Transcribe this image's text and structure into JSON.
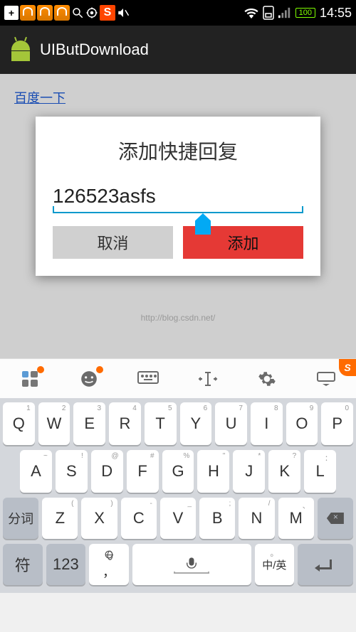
{
  "status": {
    "battery": "100",
    "time": "14:55",
    "sogou": "S"
  },
  "actionbar": {
    "title": "UIButDownload"
  },
  "page": {
    "link": "百度一下",
    "watermark": "http://blog.csdn.net/"
  },
  "dialog": {
    "title": "添加快捷回复",
    "input_value": "126523asfs",
    "cancel": "取消",
    "add": "添加"
  },
  "ime_corner": "S",
  "keys": {
    "r1": [
      {
        "main": "Q",
        "sup": "1"
      },
      {
        "main": "W",
        "sup": "2"
      },
      {
        "main": "E",
        "sup": "3"
      },
      {
        "main": "R",
        "sup": "4"
      },
      {
        "main": "T",
        "sup": "5"
      },
      {
        "main": "Y",
        "sup": "6"
      },
      {
        "main": "U",
        "sup": "7"
      },
      {
        "main": "I",
        "sup": "8"
      },
      {
        "main": "O",
        "sup": "9"
      },
      {
        "main": "P",
        "sup": "0"
      }
    ],
    "r2": [
      {
        "main": "A",
        "sup": "~"
      },
      {
        "main": "S",
        "sup": "!"
      },
      {
        "main": "D",
        "sup": "@"
      },
      {
        "main": "F",
        "sup": "#"
      },
      {
        "main": "G",
        "sup": "%"
      },
      {
        "main": "H",
        "sup": "\""
      },
      {
        "main": "J",
        "sup": "*"
      },
      {
        "main": "K",
        "sup": "?"
      },
      {
        "main": "L",
        "sup": "："
      }
    ],
    "r3": [
      {
        "main": "分词"
      },
      {
        "main": "Z",
        "sup": "("
      },
      {
        "main": "X",
        "sup": ")"
      },
      {
        "main": "C",
        "sup": "-"
      },
      {
        "main": "V",
        "sup": "_"
      },
      {
        "main": "B",
        "sup": ";"
      },
      {
        "main": "N",
        "sup": "/"
      },
      {
        "main": "M",
        "sup": "、"
      }
    ],
    "r4": {
      "sym": "符",
      "num": "123",
      "comma": "，",
      "lang": "中/英",
      "period": "。"
    }
  }
}
